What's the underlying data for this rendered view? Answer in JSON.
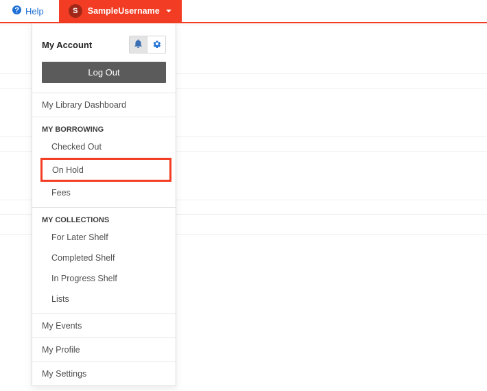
{
  "topbar": {
    "help_label": "Help",
    "user": {
      "initial": "S",
      "name": "SampleUsername"
    }
  },
  "dropdown": {
    "title": "My Account",
    "logout_label": "Log Out",
    "item_dashboard": "My Library Dashboard",
    "section_borrowing": "MY BORROWING",
    "borrowing": {
      "checked_out": "Checked Out",
      "on_hold": "On Hold",
      "fees": "Fees"
    },
    "section_collections": "MY COLLECTIONS",
    "collections": {
      "later": "For Later Shelf",
      "completed": "Completed Shelf",
      "in_progress": "In Progress Shelf",
      "lists": "Lists"
    },
    "item_events": "My Events",
    "item_profile": "My Profile",
    "item_settings": "My Settings"
  }
}
